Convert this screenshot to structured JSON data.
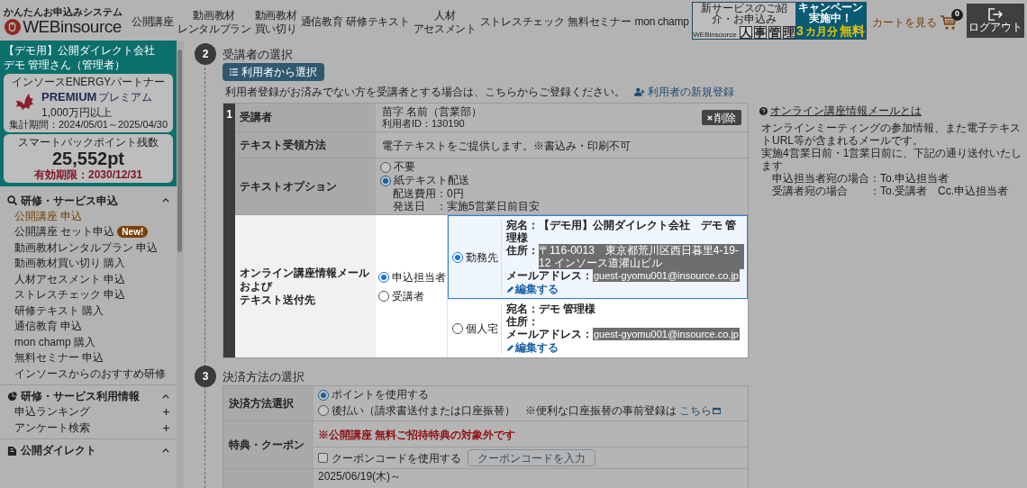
{
  "header": {
    "tagline": "かんたんお申込みシステム",
    "logo": "WEBinsource",
    "nav": [
      {
        "lines": [
          "公開講座"
        ]
      },
      {
        "lines": [
          "動画教材",
          "レンタルプラン"
        ]
      },
      {
        "lines": [
          "動画教材",
          "買い切り"
        ]
      },
      {
        "lines": [
          "通信教育"
        ]
      },
      {
        "lines": [
          "研修テキスト"
        ]
      },
      {
        "lines": [
          "人材",
          "アセスメント"
        ]
      },
      {
        "lines": [
          "ストレスチェック"
        ]
      },
      {
        "lines": [
          "無料セミナー"
        ]
      },
      {
        "lines": [
          "mon champ"
        ]
      }
    ],
    "banner": {
      "intro": "新サービスのご紹介・お申込み",
      "brand": "WEBinsource",
      "chars": [
        "人",
        "事",
        "管",
        "理"
      ],
      "campaign": "キャンペーン実施中！",
      "offer_number": "3",
      "offer_unit": "カ月分",
      "offer_word": "無料"
    },
    "cart": {
      "label": "カートを見る",
      "count": "0"
    },
    "logout": "ログアウト"
  },
  "sidebar": {
    "company": "【デモ用】公開ダイレクト会社",
    "user": "デモ 管理さん（管理者）",
    "partner": {
      "title": "インソースENERGYパートナー",
      "rank": "PREMIUM",
      "rank_kana": "プレミアム",
      "threshold": "1,000万円以上",
      "period": "集計期間：2024/05/01～2025/04/30"
    },
    "points": {
      "label": "スマートパックポイント残数",
      "value": "25,552pt",
      "expiry": "有効期限：2030/12/31"
    },
    "sections": [
      {
        "title": "研修・サービス申込",
        "expanded": true,
        "items": [
          {
            "label": "公開講座 申込",
            "selected": true,
            "has_children": false
          },
          {
            "label": "公開講座 セット申込",
            "badge": "New!",
            "selected": false,
            "has_children": false
          },
          {
            "label": "動画教材レンタルプラン 申込",
            "selected": false,
            "has_children": false
          },
          {
            "label": "動画教材買い切り 購入",
            "selected": false,
            "has_children": false
          },
          {
            "label": "人材アセスメント 申込",
            "selected": false,
            "has_children": false
          },
          {
            "label": "ストレスチェック 申込",
            "selected": false,
            "has_children": false
          },
          {
            "label": "研修テキスト 購入",
            "selected": false,
            "has_children": false
          },
          {
            "label": "通信教育 申込",
            "selected": false,
            "has_children": false
          },
          {
            "label": "mon champ 購入",
            "selected": false,
            "has_children": false
          },
          {
            "label": "無料セミナー 申込",
            "selected": false,
            "has_children": false
          },
          {
            "label": "インソースからのおすすめ研修",
            "selected": false,
            "has_children": false
          }
        ]
      },
      {
        "title": "研修・サービス利用情報",
        "expanded": true,
        "items": [
          {
            "label": "申込ランキング",
            "selected": false,
            "has_children": true
          },
          {
            "label": "アンケート検索",
            "selected": false,
            "has_children": true
          }
        ]
      },
      {
        "title": "公開ダイレクト",
        "expanded": true
      }
    ]
  },
  "step2": {
    "number": "2",
    "title": "受講者の選択",
    "select_button": "利用者から選択",
    "note": "利用者登録がお済みでない方を受講者とする場合は、こちらからご登録ください。",
    "register_link": "利用者の新規登録",
    "participant": {
      "index": "1",
      "participant_label": "受講者",
      "name": "苗字 名前（営業部）",
      "user_id": "利用者ID：130190",
      "delete": "削除",
      "text_method_label": "テキスト受領方法",
      "text_method": "電子テキストをご提供します。※書込み・印刷不可",
      "option_label": "テキストオプション",
      "options": [
        {
          "label": "不要",
          "selected": false
        },
        {
          "label": "紙テキスト配送",
          "selected": true
        }
      ],
      "shipping": [
        "配送費用：0円",
        "発送日　：実施5営業日前目安"
      ],
      "mail_label": [
        "オンライン講座情報メール",
        "および",
        "テキスト送付先"
      ],
      "recipients": [
        {
          "label": "申込担当者",
          "selected": true
        },
        {
          "label": "受講者",
          "selected": false
        }
      ],
      "destinations": [
        {
          "label": "勤務先",
          "selected": true,
          "name": "宛名：【デモ用】公開ダイレクト会社　デモ 管理様",
          "address_label": "住所：",
          "address": "〒116-0013　東京都荒川区西日暮里4-19-12 インソース道灌山ビル",
          "email_label": "メールアドレス：",
          "email": "guest-gyomu001@insource.co.jp",
          "edit": "編集する"
        },
        {
          "label": "個人宅",
          "selected": false,
          "name": "宛名：デモ 管理様",
          "address_label": "住所：",
          "email_label": "メールアドレス：",
          "email": "guest-gyomu001@insource.co.jp",
          "edit": "編集する"
        }
      ]
    },
    "info": {
      "title": "オンライン講座情報メールとは",
      "lines": [
        "オンラインミーティングの参加情報、また電子テキストURL等が含まれるメールです。",
        "実施4営業日前・1営業日前に、下記の通り送付いたします",
        "　申込担当者宛の場合：To.申込担当者",
        "　受講者宛の場合　　：To.受講者　Cc.申込担当者"
      ]
    }
  },
  "step3": {
    "number": "3",
    "title": "決済方法の選択",
    "payment_label": "決済方法選択",
    "methods": [
      {
        "label": "ポイントを使用する",
        "selected": true
      },
      {
        "label": "後払い（請求書送付または口座振替）",
        "selected": false
      }
    ],
    "payment_note": "※便利な口座振替の事前登録は",
    "payment_link": "こちら",
    "benefit_label": "特典・クーポン",
    "benefit_notice": "※公開講座 無料ご招待特典の対象外です",
    "coupon": {
      "label": "クーポンコードを使用する",
      "checked": false,
      "button": "クーポンコードを入力"
    },
    "next_date": "2025/06/19(木)～"
  }
}
